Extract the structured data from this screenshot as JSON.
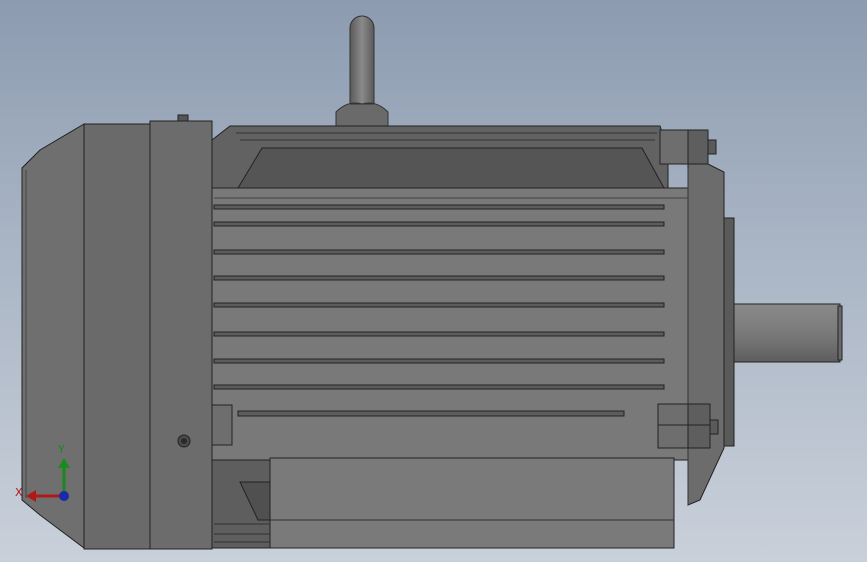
{
  "viewport": {
    "background_top": "#8c9bb0",
    "background_bottom": "#c9d0da",
    "model": "electric-motor"
  },
  "triad": {
    "x_label": "X",
    "y_label": "Y",
    "x_color": "#b01818",
    "y_color": "#1a8a1a",
    "z_color": "#1a2aa8"
  }
}
